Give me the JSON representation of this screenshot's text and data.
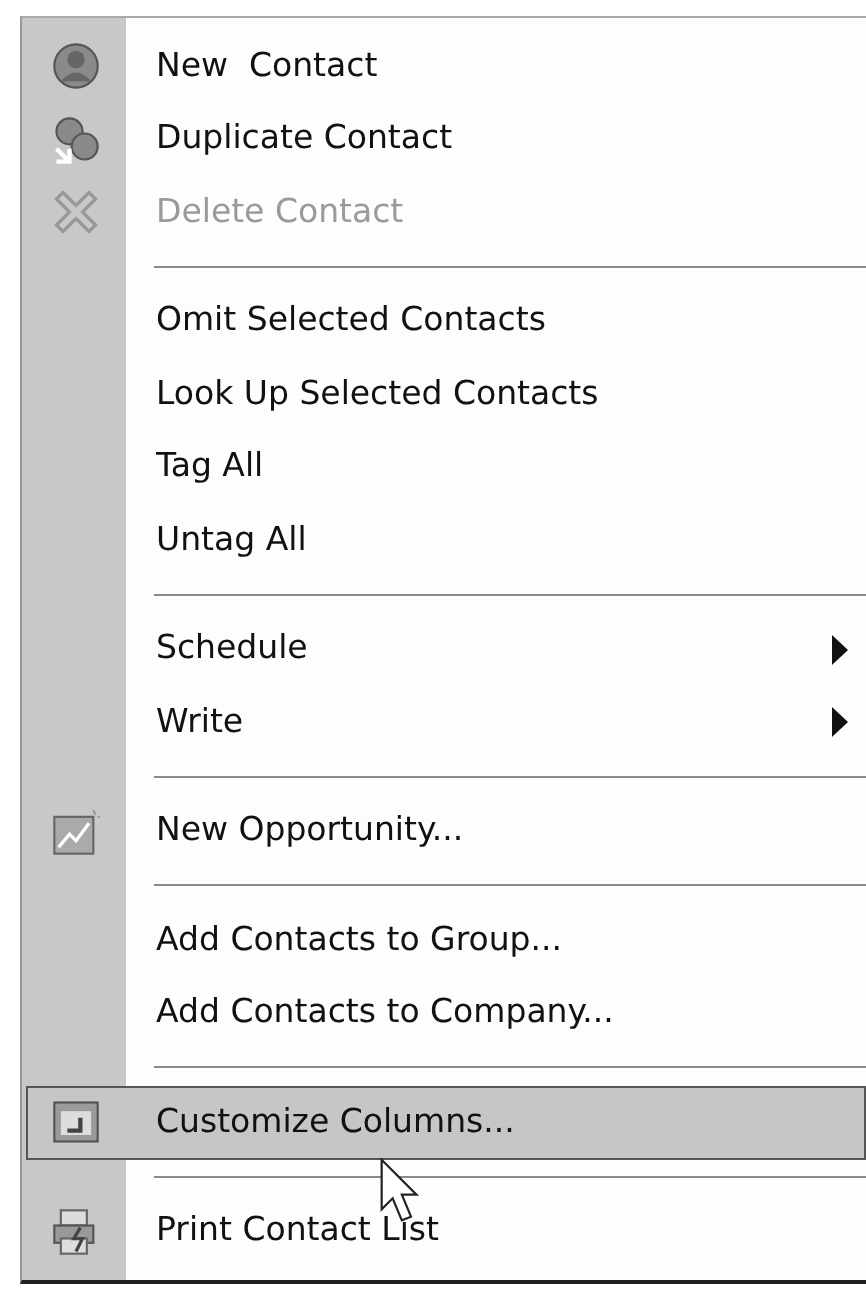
{
  "menu": {
    "items": [
      {
        "kind": "item",
        "label": "New  Contact",
        "disabled": false,
        "selected": false,
        "submenu": false
      },
      {
        "kind": "item",
        "label": "Duplicate Contact",
        "disabled": false,
        "selected": false,
        "submenu": false
      },
      {
        "kind": "item",
        "label": "Delete Contact",
        "disabled": true,
        "selected": false,
        "submenu": false
      },
      {
        "kind": "separator"
      },
      {
        "kind": "item",
        "label": "Omit Selected Contacts",
        "disabled": false,
        "selected": false,
        "submenu": false
      },
      {
        "kind": "item",
        "label": "Look Up Selected Contacts",
        "disabled": false,
        "selected": false,
        "submenu": false
      },
      {
        "kind": "item",
        "label": "Tag All",
        "disabled": false,
        "selected": false,
        "submenu": false
      },
      {
        "kind": "item",
        "label": "Untag All",
        "disabled": false,
        "selected": false,
        "submenu": false
      },
      {
        "kind": "separator"
      },
      {
        "kind": "item",
        "label": "Schedule",
        "disabled": false,
        "selected": false,
        "submenu": true
      },
      {
        "kind": "item",
        "label": "Write",
        "disabled": false,
        "selected": false,
        "submenu": true
      },
      {
        "kind": "separator"
      },
      {
        "kind": "item",
        "label": "New Opportunity...",
        "disabled": false,
        "selected": false,
        "submenu": false
      },
      {
        "kind": "separator"
      },
      {
        "kind": "item",
        "label": "Add Contacts to Group...",
        "disabled": false,
        "selected": false,
        "submenu": false
      },
      {
        "kind": "item",
        "label": "Add Contacts to Company...",
        "disabled": false,
        "selected": false,
        "submenu": false
      },
      {
        "kind": "separator"
      },
      {
        "kind": "item",
        "label": "Customize Columns...",
        "disabled": false,
        "selected": true,
        "submenu": false
      },
      {
        "kind": "separator"
      },
      {
        "kind": "item",
        "label": "Print Contact List",
        "disabled": false,
        "selected": false,
        "submenu": false
      }
    ]
  }
}
